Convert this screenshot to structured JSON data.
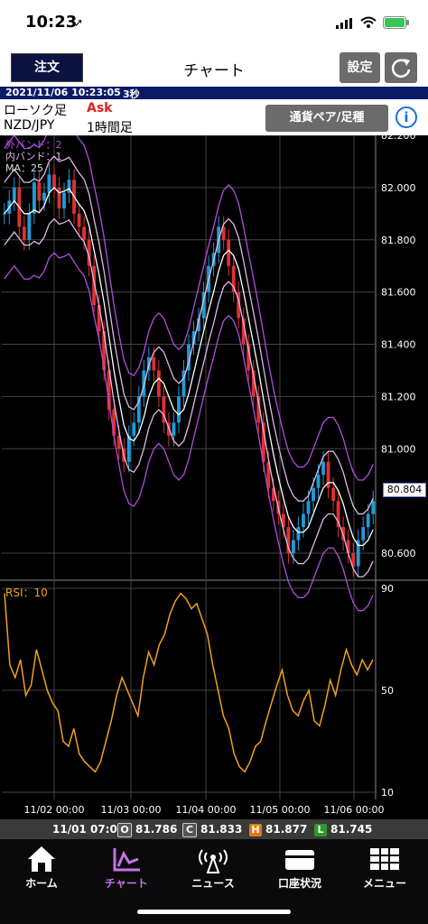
{
  "status": {
    "time": "10:23"
  },
  "topbar": {
    "order_button": "注文",
    "title": "チャート",
    "settings_button": "設定"
  },
  "info": {
    "datetime": "2021/11/06 10:23:05",
    "interval": "3秒",
    "candle_type": "ローソク足",
    "price_side": "Ask",
    "pair": "NZD/JPY",
    "timeframe": "1時間足",
    "pair_button": "通貨ペア/足種"
  },
  "legend": {
    "outer_band": "外バンド：2",
    "inner_band": "内バンド：1",
    "ma": "MA：25"
  },
  "rsi_label": "RSI：10",
  "colors": {
    "up": "#1f9bd6",
    "down": "#e03030",
    "band_outer": "#b04de0",
    "band_inner": "#e0b8e8",
    "ma": "#ffffff",
    "rsi": "#f0a020",
    "grid": "#444444"
  },
  "chart_data": [
    {
      "type": "candlestick",
      "title": "NZD/JPY",
      "x_ticks": [
        "11/02 00:00",
        "11/03 00:00",
        "11/04 00:00",
        "11/05 00:00",
        "11/06 00:00"
      ],
      "y_ticks": [
        "82.200",
        "82.000",
        "81.800",
        "81.600",
        "81.400",
        "81.200",
        "81.000",
        "80.600"
      ],
      "ylim": [
        80.5,
        82.2
      ],
      "current_price": "80.804",
      "close_series": [
        81.9,
        81.95,
        82.0,
        81.85,
        81.8,
        81.9,
        82.02,
        81.95,
        81.98,
        82.05,
        82.0,
        81.92,
        81.98,
        82.03,
        81.9,
        81.85,
        81.8,
        81.7,
        81.55,
        81.45,
        81.3,
        81.15,
        81.05,
        81.0,
        80.95,
        81.05,
        81.1,
        81.2,
        81.3,
        81.35,
        81.3,
        81.2,
        81.1,
        81.05,
        81.1,
        81.2,
        81.3,
        81.4,
        81.45,
        81.5,
        81.6,
        81.7,
        81.75,
        81.85,
        81.8,
        81.7,
        81.6,
        81.5,
        81.4,
        81.3,
        81.2,
        81.1,
        80.95,
        80.85,
        80.8,
        80.75,
        80.7,
        80.6,
        80.65,
        80.7,
        80.75,
        80.8,
        80.85,
        80.9,
        80.95,
        80.85,
        80.8,
        80.7,
        80.65,
        80.6,
        80.55,
        80.65,
        80.7,
        80.75,
        80.8
      ],
      "bands": {
        "outer": "2",
        "inner": "1",
        "ma": "25"
      }
    },
    {
      "type": "line",
      "title": "RSI：10",
      "y_ticks": [
        "90",
        "50",
        "10"
      ],
      "ylim": [
        10,
        90
      ],
      "values": [
        88,
        60,
        55,
        62,
        48,
        52,
        66,
        58,
        50,
        45,
        42,
        30,
        28,
        35,
        25,
        22,
        20,
        18,
        22,
        30,
        38,
        48,
        55,
        50,
        45,
        40,
        55,
        65,
        60,
        68,
        72,
        80,
        85,
        88,
        86,
        82,
        84,
        78,
        72,
        60,
        50,
        40,
        35,
        25,
        20,
        18,
        22,
        28,
        30,
        38,
        45,
        52,
        58,
        48,
        42,
        40,
        46,
        50,
        38,
        36,
        44,
        54,
        48,
        58,
        66,
        60,
        56,
        62,
        58,
        62
      ]
    }
  ],
  "ohlc": {
    "time": "11/01 07:00",
    "O": "81.786",
    "C": "81.833",
    "H": "81.877",
    "L": "81.745"
  },
  "tabs": [
    {
      "label": "ホーム"
    },
    {
      "label": "チャート"
    },
    {
      "label": "ニュース"
    },
    {
      "label": "口座状況"
    },
    {
      "label": "メニュー"
    }
  ]
}
